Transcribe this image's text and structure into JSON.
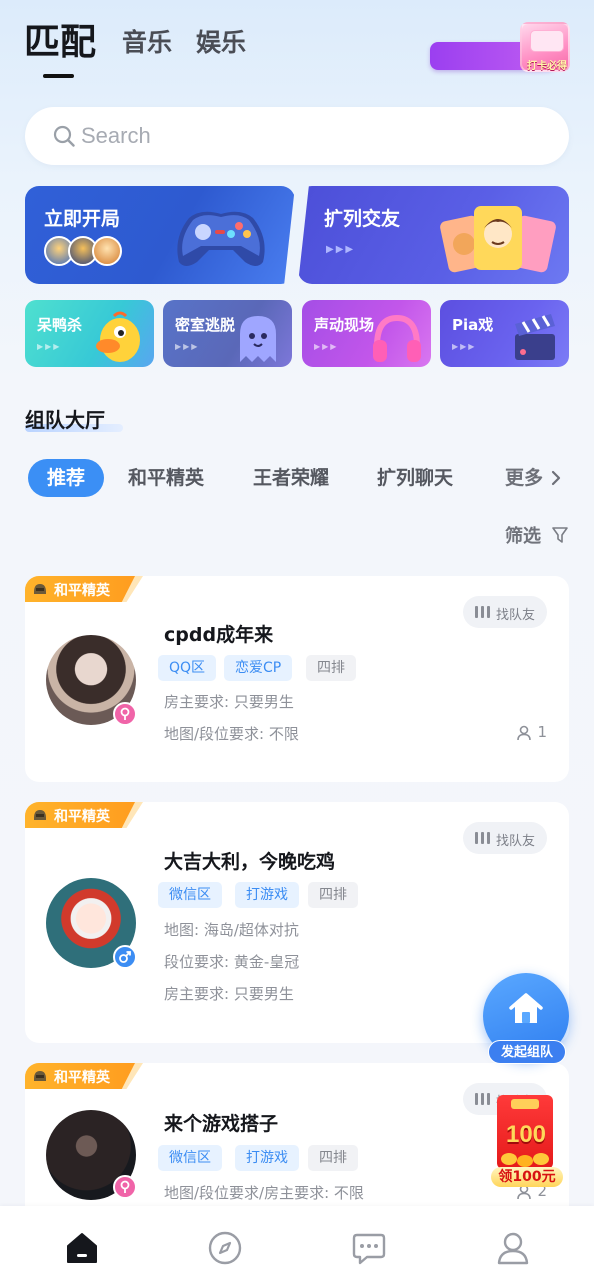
{
  "top_tabs": [
    {
      "label": "匹配",
      "active": true
    },
    {
      "label": "音乐",
      "active": false
    },
    {
      "label": "娱乐",
      "active": false
    }
  ],
  "promo": {
    "label": "打卡必得"
  },
  "search": {
    "placeholder": "Search",
    "value": ""
  },
  "feature_cards": [
    {
      "title": "立即开局",
      "art": "gamepad-icon"
    },
    {
      "title": "扩列交友",
      "art": "friend-cards-icon"
    }
  ],
  "mode_cards": [
    {
      "title": "呆鸭杀",
      "art": "duck-icon"
    },
    {
      "title": "密室逃脱",
      "art": "ghost-icon"
    },
    {
      "title": "声动现场",
      "art": "headphones-icon"
    },
    {
      "title": "Pia戏",
      "art": "clapperboard-icon"
    }
  ],
  "section": {
    "title": "组队大厅"
  },
  "filter_tabs": [
    {
      "label": "推荐",
      "active": true
    },
    {
      "label": "和平精英",
      "active": false
    },
    {
      "label": "王者荣耀",
      "active": false
    },
    {
      "label": "扩列聊天",
      "active": false
    },
    {
      "label": "更多",
      "active": false
    }
  ],
  "screen_label": "筛选",
  "team_cards": [
    {
      "game": "和平精英",
      "find_label": "找队友",
      "title": "cpdd成年来",
      "gender": "female",
      "tags": [
        {
          "label": "QQ区",
          "style": "blue"
        },
        {
          "label": "恋爱CP",
          "style": "blue"
        },
        {
          "label": "四排",
          "style": "gray"
        }
      ],
      "requirements": [
        "房主要求: 只要男生",
        "地图/段位要求: 不限"
      ],
      "count": "1"
    },
    {
      "game": "和平精英",
      "find_label": "找队友",
      "title": "大吉大利，今晚吃鸡",
      "gender": "male",
      "tags": [
        {
          "label": "微信区",
          "style": "blue"
        },
        {
          "label": "打游戏",
          "style": "blue"
        },
        {
          "label": "四排",
          "style": "gray"
        }
      ],
      "requirements": [
        "地图: 海岛/超体对抗",
        "段位要求: 黄金-皇冠",
        "房主要求: 只要男生"
      ],
      "count": ""
    },
    {
      "game": "和平精英",
      "find_label": "找队友",
      "title": "来个游戏搭子",
      "gender": "female",
      "tags": [
        {
          "label": "微信区",
          "style": "blue"
        },
        {
          "label": "打游戏",
          "style": "blue"
        },
        {
          "label": "四排",
          "style": "gray"
        }
      ],
      "requirements": [
        "地图/段位要求/房主要求: 不限"
      ],
      "count": "2"
    }
  ],
  "fab": {
    "label": "发起组队",
    "icon": "house-icon"
  },
  "red_packet": {
    "amount": "100",
    "label": "领100元"
  },
  "bottom_nav": [
    {
      "name": "home",
      "icon": "home-icon",
      "active": true
    },
    {
      "name": "discover",
      "icon": "compass-icon",
      "active": false
    },
    {
      "name": "messages",
      "icon": "chat-icon",
      "active": false
    },
    {
      "name": "profile",
      "icon": "user-icon",
      "active": false
    }
  ],
  "colors": {
    "accent": "#3b8ff5",
    "tag_orange": "#ffa726",
    "chip_blue_bg": "#e7f2ff",
    "chip_blue_text": "#3c8df3",
    "female": "#f064a8",
    "male": "#3c8df3"
  }
}
